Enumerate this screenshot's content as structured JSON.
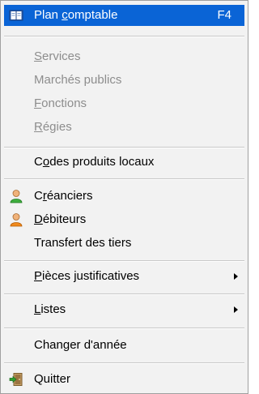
{
  "menu": {
    "plan_comptable": {
      "pre": "Plan ",
      "key": "c",
      "post": "omptable",
      "shortcut": "F4"
    },
    "services": {
      "pre": "",
      "key": "S",
      "post": "ervices"
    },
    "marches_publics": {
      "label": "Marchés publics"
    },
    "fonctions": {
      "pre": "",
      "key": "F",
      "post": "onctions"
    },
    "regies": {
      "pre": "",
      "key": "R",
      "post": "égies"
    },
    "codes_produits": {
      "pre": "C",
      "key": "o",
      "post": "des produits locaux"
    },
    "creanciers": {
      "pre": "C",
      "key": "r",
      "post": "éanciers"
    },
    "debiteurs": {
      "pre": "",
      "key": "D",
      "post": "ébiteurs"
    },
    "transfert": {
      "label": "Transfert des tiers"
    },
    "pieces": {
      "pre": "",
      "key": "P",
      "post": "ièces justificatives"
    },
    "listes": {
      "pre": "",
      "key": "L",
      "post": "istes"
    },
    "changer_annee": {
      "label": "Changer d'année"
    },
    "quitter": {
      "label": "Quitter"
    }
  },
  "colors": {
    "highlight": "#0a64d6",
    "disabled_text": "#8d8d8d",
    "menu_background": "#f2f2f2"
  },
  "icons": {
    "plan_comptable": "book-icon",
    "creanciers": "person-green-icon",
    "debiteurs": "person-orange-icon",
    "quitter": "exit-door-icon"
  }
}
